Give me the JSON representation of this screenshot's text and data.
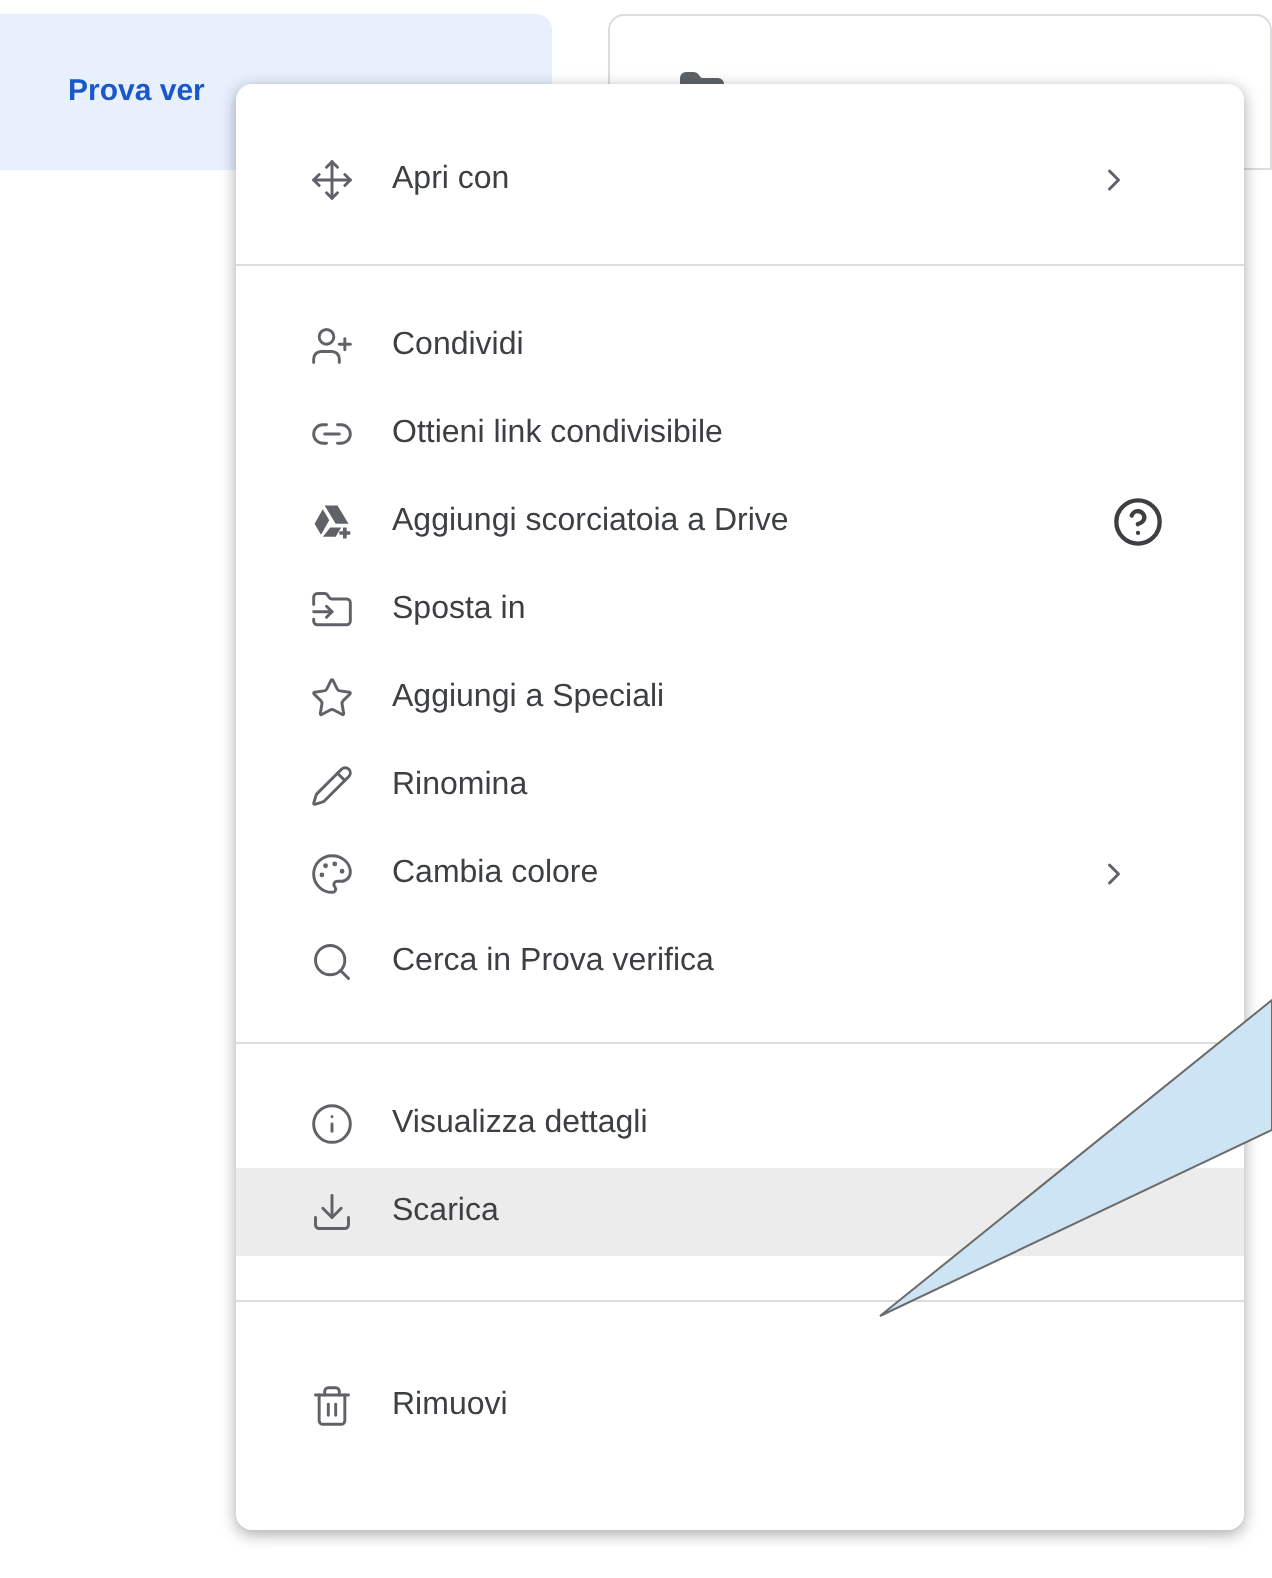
{
  "cards": [
    {
      "title": "Prova ver",
      "selected": true
    },
    {
      "selected": false
    }
  ],
  "menu": {
    "sections": [
      {
        "items": [
          {
            "label": "Apri con",
            "submenu": true,
            "help": false,
            "selected": false
          }
        ]
      },
      {
        "items": [
          {
            "label": "Condividi",
            "submenu": false,
            "help": false,
            "selected": false
          },
          {
            "label": "Ottieni link condivisibile",
            "submenu": false,
            "help": false,
            "selected": false
          },
          {
            "label": "Aggiungi scorciatoia a Drive",
            "submenu": false,
            "help": true,
            "selected": false
          },
          {
            "label": "Sposta in",
            "submenu": false,
            "help": false,
            "selected": false
          },
          {
            "label": "Aggiungi a Speciali",
            "submenu": false,
            "help": false,
            "selected": false
          },
          {
            "label": "Rinomina",
            "submenu": false,
            "help": false,
            "selected": false
          },
          {
            "label": "Cambia colore",
            "submenu": true,
            "help": false,
            "selected": false
          },
          {
            "label": "Cerca in Prova verifica",
            "submenu": false,
            "help": false,
            "selected": false
          }
        ]
      },
      {
        "items": [
          {
            "label": "Visualizza dettagli",
            "submenu": false,
            "help": false,
            "selected": false
          },
          {
            "label": "Scarica",
            "submenu": false,
            "help": false,
            "selected": true
          }
        ]
      },
      {
        "items": [
          {
            "label": "Rimuovi",
            "submenu": false,
            "help": false,
            "selected": false
          }
        ]
      }
    ]
  }
}
